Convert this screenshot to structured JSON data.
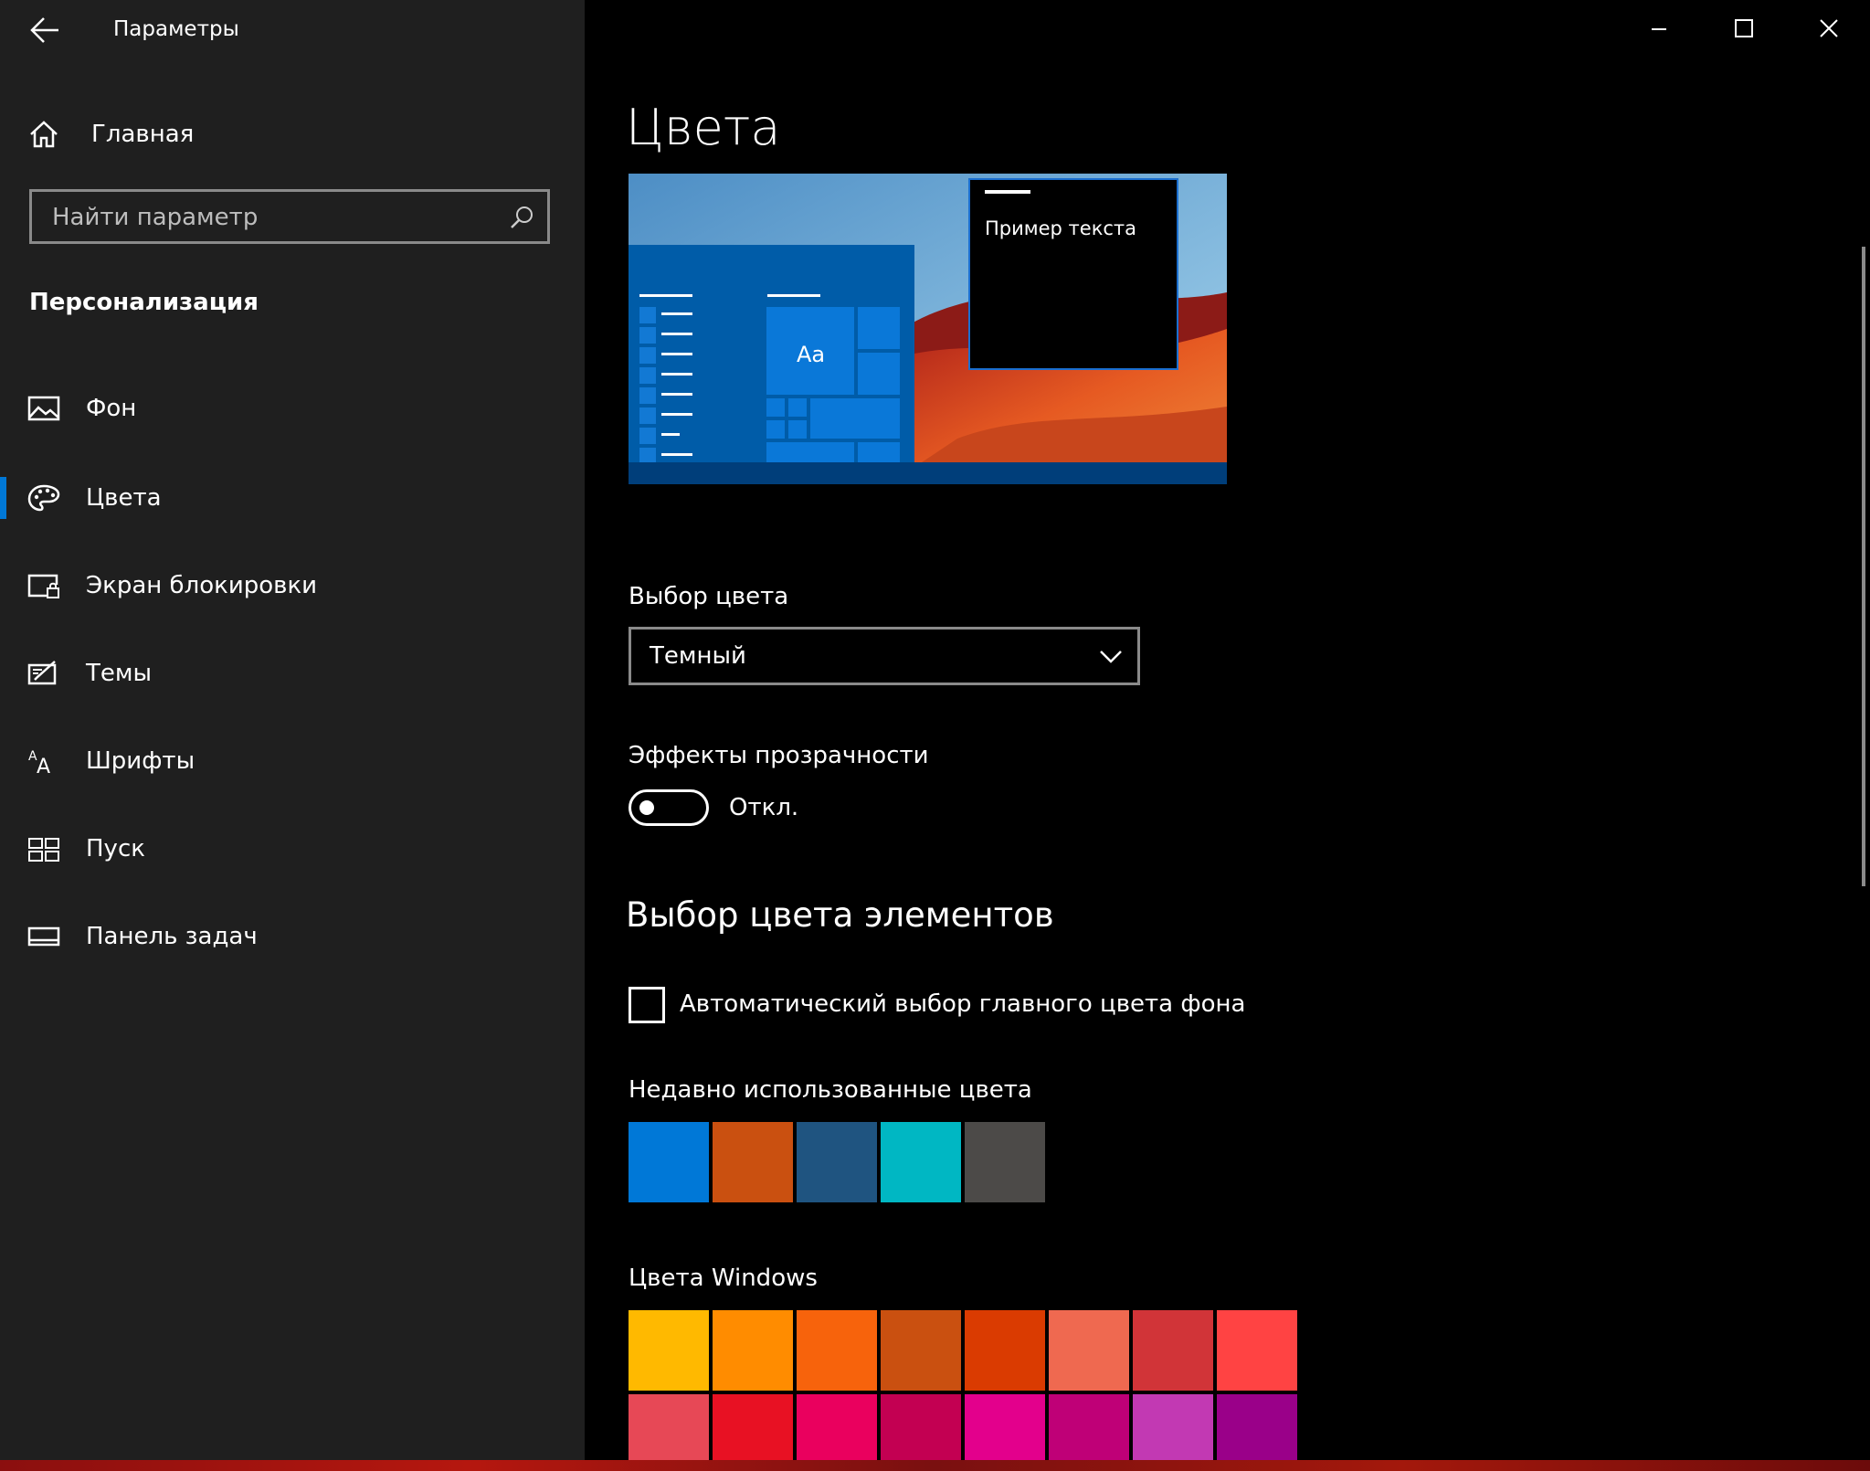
{
  "window": {
    "title": "Параметры",
    "controls": [
      "minimize",
      "maximize",
      "close"
    ]
  },
  "sidebar": {
    "home_label": "Главная",
    "search_placeholder": "Найти параметр",
    "section_title": "Персонализация",
    "items": [
      {
        "label": "Фон",
        "icon": "picture-icon",
        "active": false
      },
      {
        "label": "Цвета",
        "icon": "palette-icon",
        "active": true
      },
      {
        "label": "Экран блокировки",
        "icon": "lock-screen-icon",
        "active": false
      },
      {
        "label": "Темы",
        "icon": "themes-icon",
        "active": false
      },
      {
        "label": "Шрифты",
        "icon": "fonts-icon",
        "active": false
      },
      {
        "label": "Пуск",
        "icon": "start-icon",
        "active": false
      },
      {
        "label": "Панель задач",
        "icon": "taskbar-icon",
        "active": false
      }
    ]
  },
  "main": {
    "page_title": "Цвета",
    "preview": {
      "sample_text": "Пример текста",
      "tile_text": "Aa"
    },
    "color_choice": {
      "label": "Выбор цвета",
      "value": "Темный"
    },
    "transparency": {
      "label": "Эффекты прозрачности",
      "state_label": "Откл.",
      "on": false
    },
    "accent_section": {
      "title": "Выбор цвета элементов",
      "auto_label": "Автоматический выбор главного цвета фона",
      "auto_checked": false
    },
    "recent_colors": {
      "label": "Недавно использованные цвета",
      "colors": [
        "#0078d7",
        "#ca5010",
        "#1f5480",
        "#00b7c3",
        "#4c4a48"
      ]
    },
    "windows_colors": {
      "label": "Цвета Windows",
      "rows": [
        [
          "#ffb900",
          "#ff8c00",
          "#f7630c",
          "#ca5010",
          "#da3b01",
          "#ef6950",
          "#d13438",
          "#ff4343"
        ],
        [
          "#e74856",
          "#e81123",
          "#ea005e",
          "#c30052",
          "#e3008c",
          "#bf0077",
          "#c239b3",
          "#9a0089"
        ]
      ]
    }
  }
}
